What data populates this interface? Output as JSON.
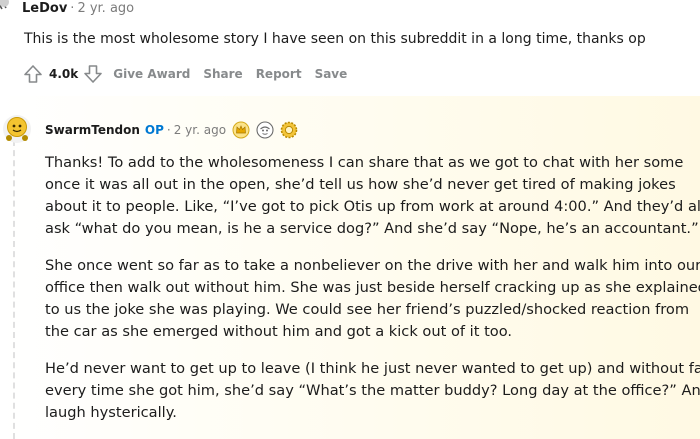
{
  "parent_comment": {
    "author": "LeDov",
    "separator": "·",
    "time": "2 yr. ago",
    "body": "This is the most wholesome story I have seen on this subreddit in a long time, thanks op",
    "score": "4.0k",
    "actions": [
      "Give Award",
      "Share",
      "Report",
      "Save"
    ]
  },
  "reply_comment": {
    "author": "SwarmTendon",
    "op_badge": "OP",
    "separator": "·",
    "time": "2 yr. ago",
    "awards": [
      "crown-award-icon",
      "face-award-icon",
      "gear-award-icon"
    ],
    "body_lines": [
      [
        "Thanks! To add to the wholesomeness I can share that as we got to chat with her some",
        "once it was all out in the open, she’d tell us how she’d never get tired of making jokes",
        "about it to people. Like, “I’ve got to pick Otis up from work at around 4:00.” And they’d all",
        "ask “what do you mean, is he a service dog?” And she’d say “Nope, he’s an accountant.”"
      ],
      [
        "She once went so far as to take a nonbeliever on the drive with her and walk him into our",
        "office then walk out without him. She was just beside herself cracking up as she explained",
        "to us the joke she was playing. We could see her friend’s puzzled/shocked reaction from",
        "the car as she emerged without him and got a kick out of it too."
      ],
      [
        "He’d never want to get up to leave (I think he just never wanted to get up) and without fail,",
        "every time she got him, she’d say “What’s the matter buddy? Long day at the office?” And",
        "laugh hysterically."
      ]
    ]
  },
  "colors": {
    "text": "#1c1c1c",
    "meta": "#7c7c7c",
    "action": "#878a8c",
    "op_blue": "#0079d3",
    "reply_tint": "#fff9e3"
  }
}
